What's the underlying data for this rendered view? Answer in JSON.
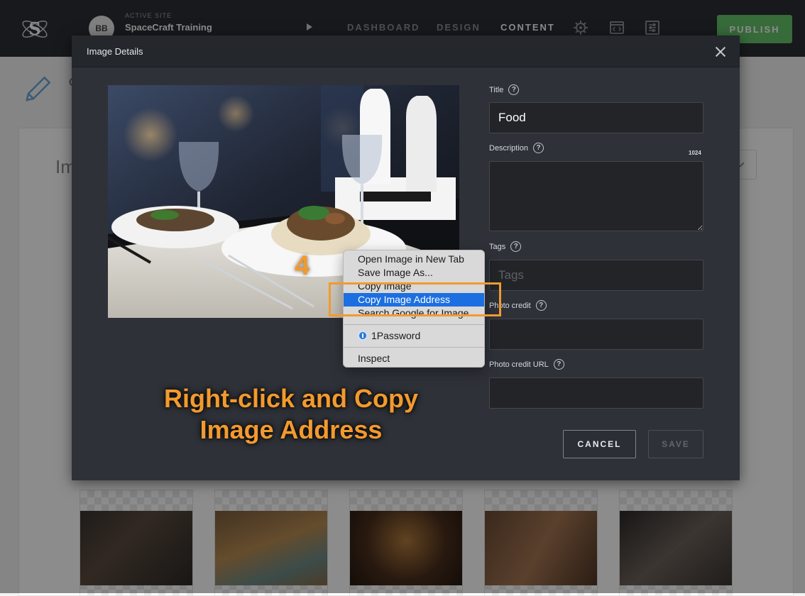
{
  "header": {
    "site_avatar": "BB",
    "site_caption": "ACTIVE SITE",
    "site_name": "SpaceCraft Training",
    "nav": [
      "DASHBOARD",
      "DESIGN",
      "CONTENT"
    ],
    "active_nav": "CONTENT",
    "nav_icons": [
      "gear-icon",
      "preview-icon",
      "settings-sliders-icon"
    ],
    "publish_label": "PUBLISH"
  },
  "page": {
    "heading_fragment": "Im",
    "title_fragment": "C"
  },
  "modal": {
    "title": "Image Details",
    "fields": {
      "title": {
        "label": "Title",
        "value": "Food"
      },
      "description": {
        "label": "Description",
        "value": "",
        "char_count": "1024"
      },
      "tags": {
        "label": "Tags",
        "placeholder": "Tags"
      },
      "photo_credit": {
        "label": "Photo credit",
        "value": ""
      },
      "photo_credit_url": {
        "label": "Photo credit URL",
        "value": ""
      }
    },
    "cancel_label": "CANCEL",
    "save_label": "SAVE"
  },
  "context_menu": {
    "items": [
      "Open Image in New Tab",
      "Save Image As...",
      "Copy Image",
      "Copy Image Address",
      "Search Google for Image",
      "1Password",
      "Inspect"
    ],
    "highlighted": "Copy Image Address"
  },
  "annotation": {
    "step": "4",
    "caption_line1": "Right-click and Copy",
    "caption_line2": "Image Address"
  },
  "colors": {
    "accent": "#f29a2e",
    "publish": "#65c46b",
    "menu_highlight": "#1c6fe0",
    "modal_bg": "#2e3138"
  }
}
